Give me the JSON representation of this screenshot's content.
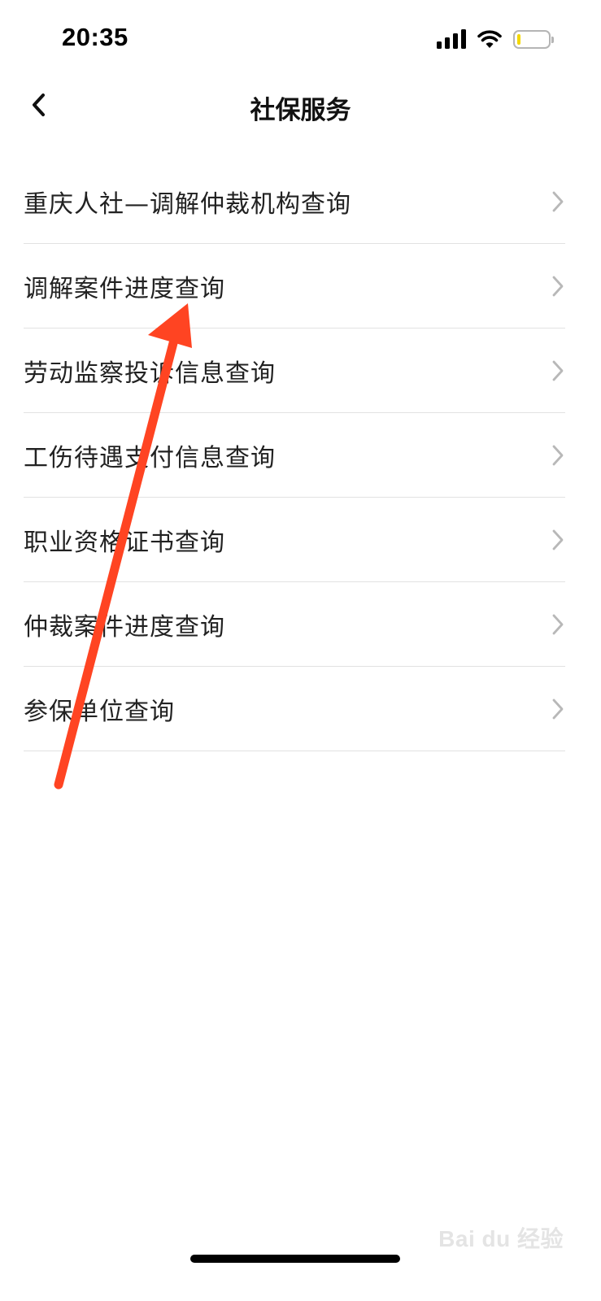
{
  "status_bar": {
    "time": "20:35",
    "icons": [
      "signal-icon",
      "wifi-icon",
      "battery-icon"
    ],
    "battery_level": 0.12,
    "battery_color": "#f4d800"
  },
  "nav": {
    "back_icon": "chevron-left-icon",
    "title": "社保服务"
  },
  "menu": {
    "items": [
      {
        "label": "重庆人社—调解仲裁机构查询"
      },
      {
        "label": "调解案件进度查询"
      },
      {
        "label": "劳动监察投诉信息查询"
      },
      {
        "label": "工伤待遇支付信息查询"
      },
      {
        "label": "职业资格证书查询"
      },
      {
        "label": "仲裁案件进度查询"
      },
      {
        "label": "参保单位查询"
      }
    ]
  },
  "annotation": {
    "type": "arrow",
    "color": "#ff4422",
    "points_to": "调解案件进度查询"
  },
  "watermark": {
    "text": "Bai du 经验"
  },
  "colors": {
    "divider": "#e2e2e2",
    "chevron": "#b8b8b8"
  }
}
